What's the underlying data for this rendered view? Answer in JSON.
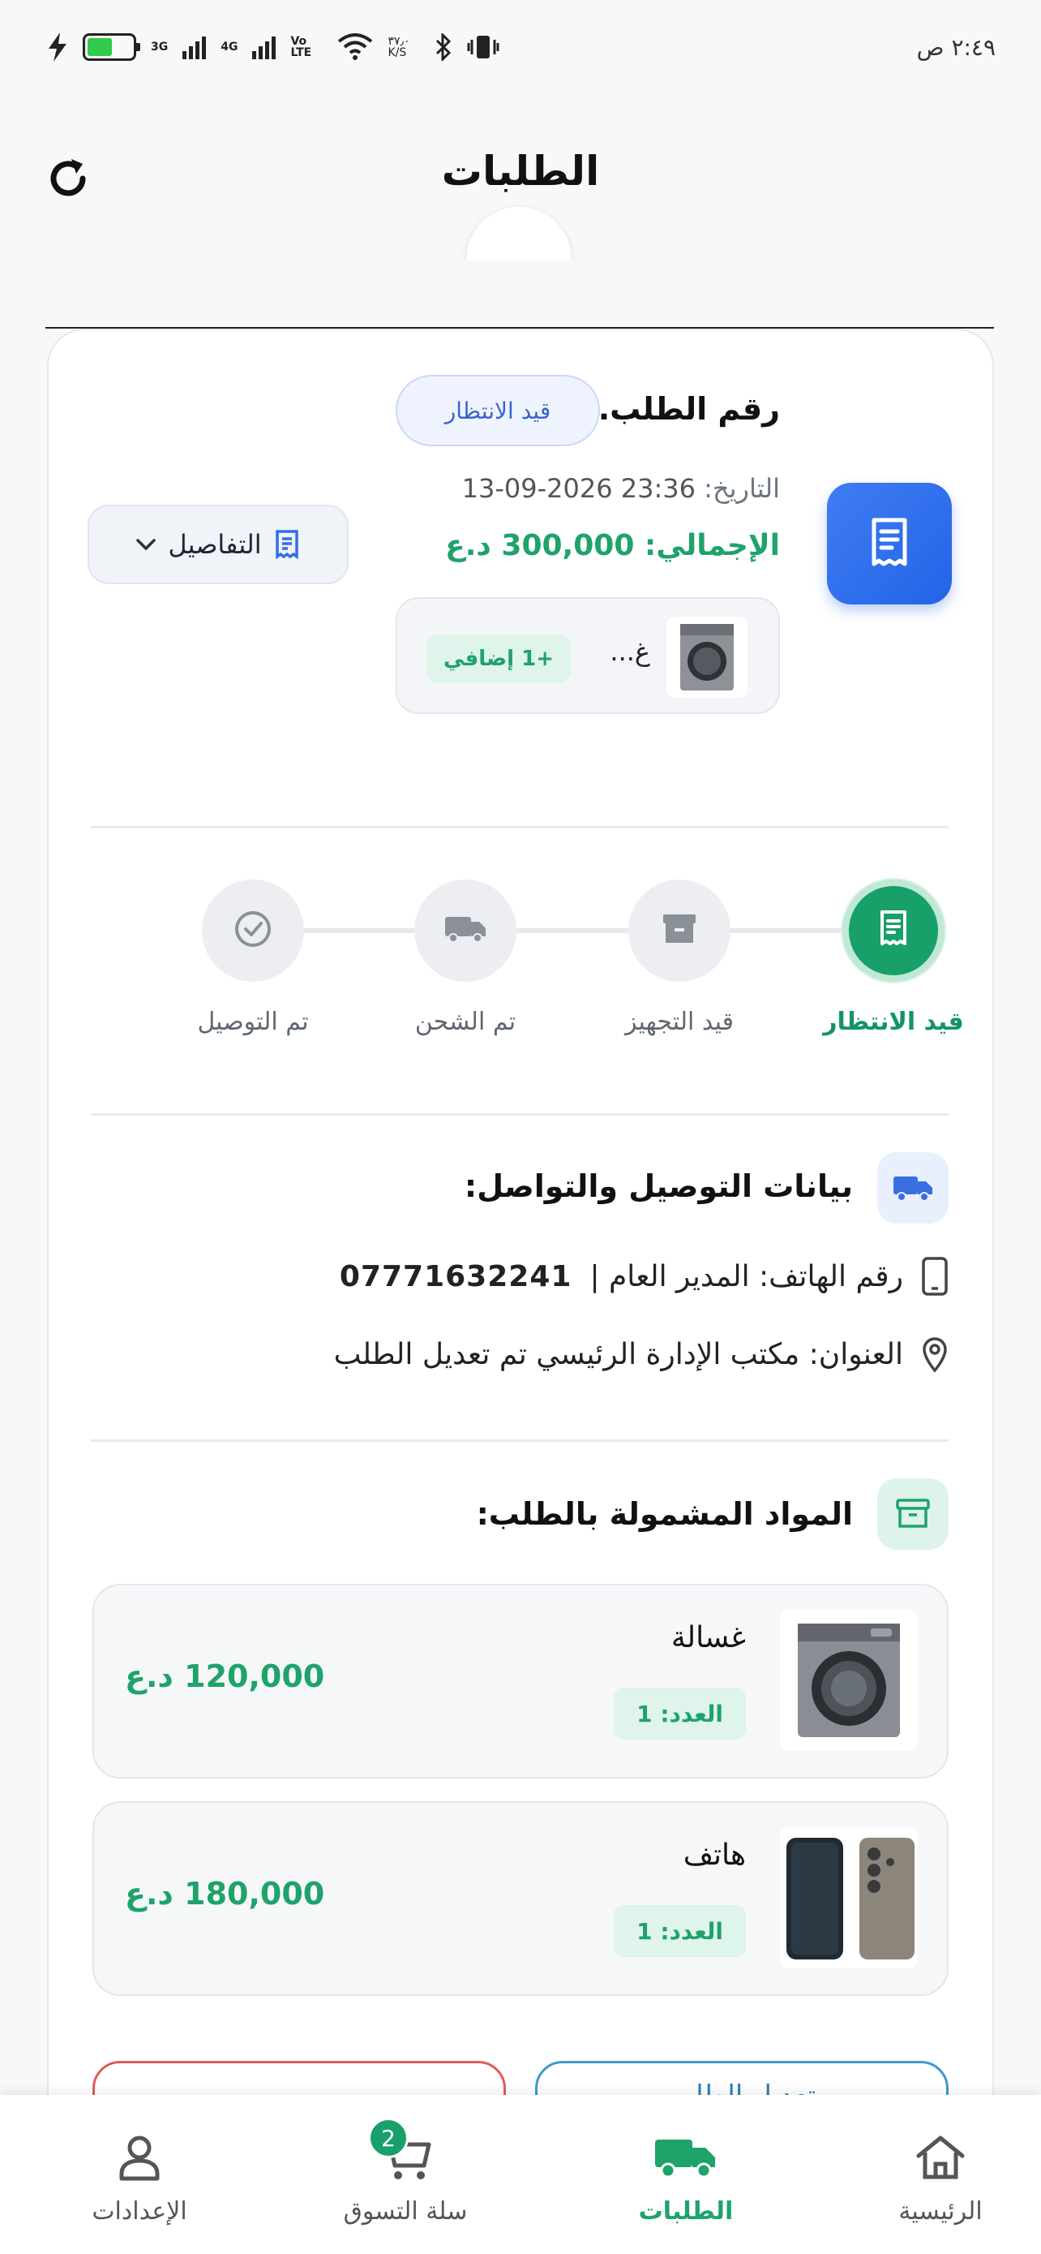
{
  "status_bar": {
    "time": "٢:٤٩ ص",
    "battery": "0",
    "network_3g": "3G",
    "network_4g": "4G",
    "volte": "Vo LTE",
    "speed": "٣٧٫٠ K/S"
  },
  "header": {
    "title": "الطلبات"
  },
  "order": {
    "title": "رقم الطلب...",
    "status": "قيد الانتظار",
    "date_label": "التاريخ:",
    "date_value": "13-09-2026 23:36",
    "total": "الإجمالي: 300,000 د.ع",
    "details_label": "التفاصيل",
    "preview_name": "غ...",
    "extra_badge": "+1 إضافي"
  },
  "tracker": {
    "progress_step": 1,
    "steps": [
      {
        "label": "قيد الانتظار",
        "icon": "receipt-icon",
        "active": true
      },
      {
        "label": "قيد التجهيز",
        "icon": "archive-box-icon",
        "active": false
      },
      {
        "label": "تم الشحن",
        "icon": "truck-icon",
        "active": false
      },
      {
        "label": "تم التوصيل",
        "icon": "check-circle-icon",
        "active": false
      }
    ]
  },
  "delivery": {
    "title": "بيانات التوصيل والتواصل:",
    "phone_text": "رقم الهاتف: المدير العام |",
    "phone_number": "07771632241",
    "address_text": "العنوان: مكتب الإدارة الرئيسي  تم تعديل الطلب"
  },
  "items_section": {
    "title": "المواد المشمولة بالطلب:",
    "items": [
      {
        "name": "غسالة",
        "qty": "العدد: 1",
        "price": "120,000 د.ع",
        "icon": "washing-machine-image"
      },
      {
        "name": "هاتف",
        "qty": "العدد: 1",
        "price": "180,000 د.ع",
        "icon": "phones-image"
      }
    ]
  },
  "actions": {
    "edit_label": "تعديل الطلب"
  },
  "bottom_nav": {
    "items": [
      {
        "label": "الرئيسية",
        "icon": "home-icon",
        "active": false
      },
      {
        "label": "الطلبات",
        "icon": "truck-icon",
        "active": true
      },
      {
        "label": "سلة التسوق",
        "icon": "cart-icon",
        "active": false,
        "badge": "2"
      },
      {
        "label": "الإعدادات",
        "icon": "user-icon",
        "active": false
      }
    ]
  },
  "colors": {
    "accent_green": "#1ea36a",
    "accent_blue": "#2f6fe8",
    "pending_pill_text": "#3a66c8",
    "cancel_border": "#e05a5a"
  }
}
